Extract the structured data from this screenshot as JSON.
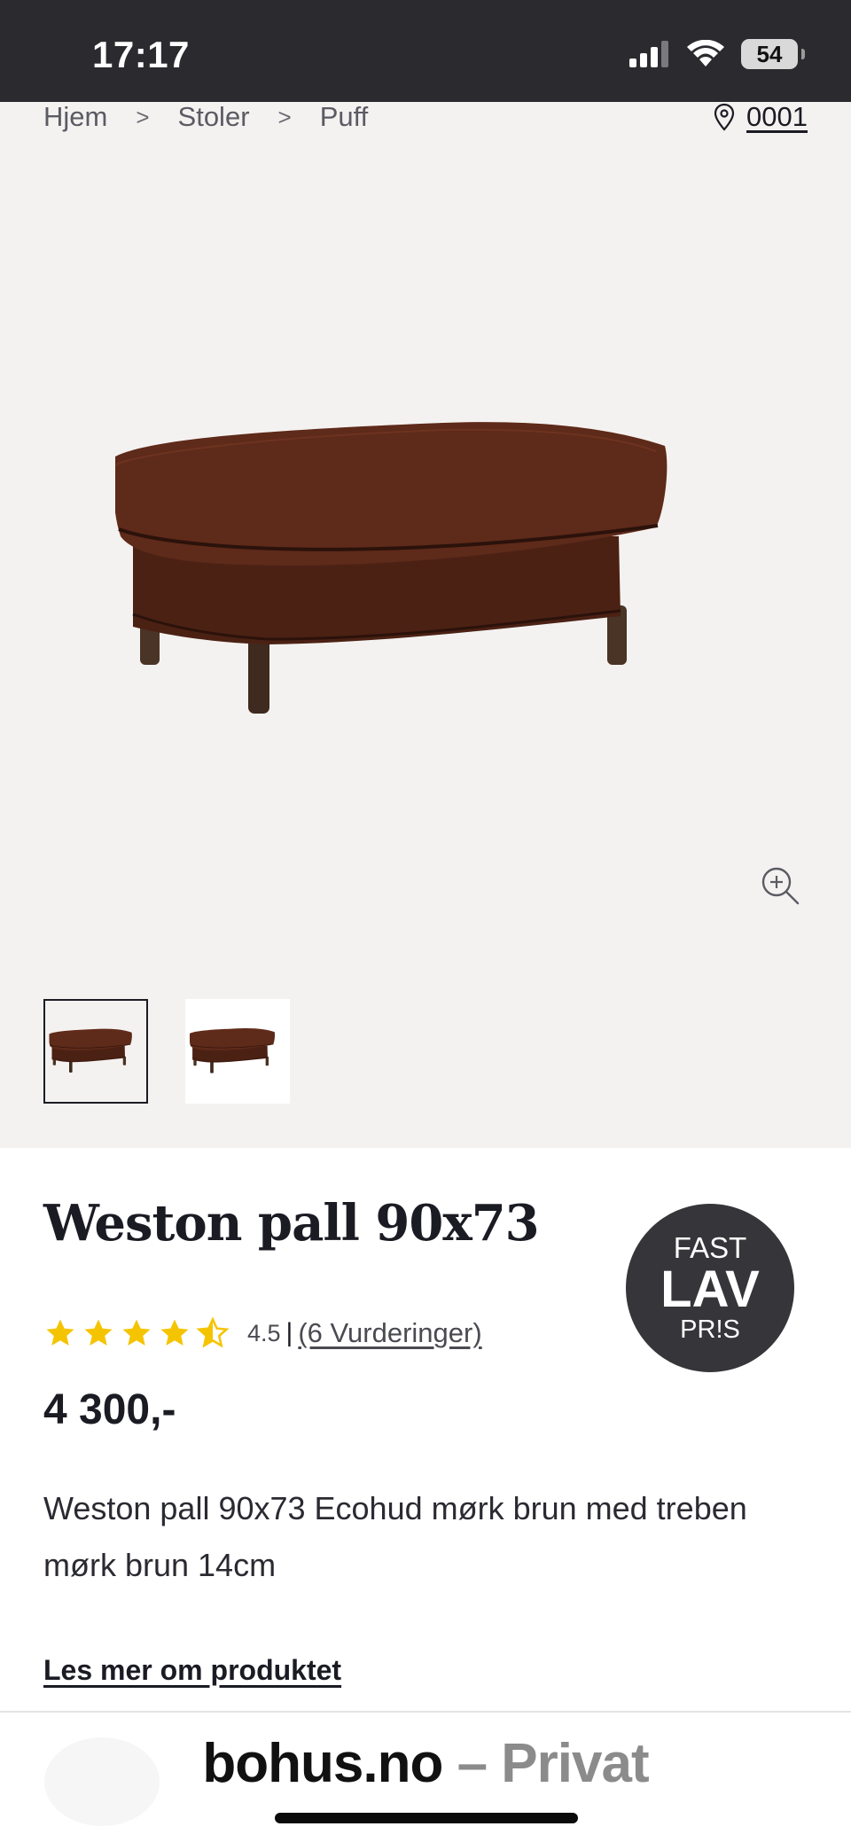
{
  "status_bar": {
    "time": "17:17",
    "battery_level": "54",
    "icons": [
      "signal-icon",
      "wifi-icon",
      "battery-icon"
    ]
  },
  "breadcrumb": {
    "items": [
      "Hjem",
      "Stoler",
      "Puff"
    ],
    "separator": ">"
  },
  "store": {
    "label": "0001",
    "icon": "location-pin-icon"
  },
  "gallery": {
    "thumbnail_count": 2,
    "active_index": 0,
    "zoom_icon": "zoom-in-icon"
  },
  "product": {
    "title": "Weston pall 90x73",
    "badge": {
      "line1": "FAST",
      "line2": "LAV",
      "line3": "PR!S"
    },
    "rating": {
      "value": "4.5",
      "value_numeric": 4.5,
      "max": 5,
      "separator": "|",
      "count_label": "(6 Vurderinger)"
    },
    "price": "4 300,-",
    "description": "Weston pall 90x73 Ecohud mørk brun med treben mørk brun 14cm",
    "read_more": "Les mer om produktet"
  },
  "browser": {
    "domain": "bohus.no",
    "suffix": " – Privat"
  },
  "colors": {
    "status_bar_bg": "#2b2b2f",
    "hero_bg": "#f4f2f0",
    "text_dark": "#1b1b24",
    "star_yellow": "#f5c400",
    "badge_bg": "#35353a",
    "leather_brown": "#4e2316"
  }
}
